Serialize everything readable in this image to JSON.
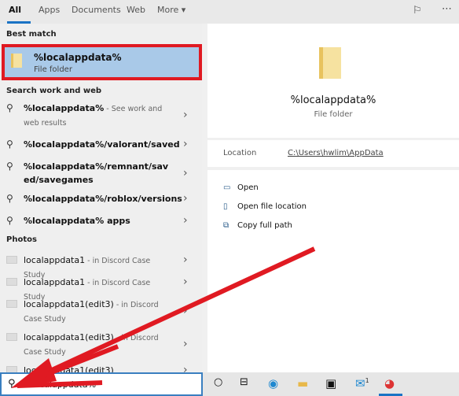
{
  "tabs": [
    "All",
    "Apps",
    "Documents",
    "Web",
    "More ▾"
  ],
  "best_match": {
    "heading": "Best match",
    "title": "%localappdata%",
    "subtitle": "File folder"
  },
  "web": {
    "heading": "Search work and web",
    "items": [
      {
        "bold": "%localappdata%",
        "rest": " - See work and web results"
      },
      {
        "bold": "",
        "rest": "%localappdata%/valorant/saved",
        "boldRest": true
      },
      {
        "bold": "",
        "rest": "%localappdata%/remnant/saved/savegames",
        "boldRest": true
      },
      {
        "bold": "",
        "rest": "%localappdata%/roblox/versions",
        "boldRest": true
      },
      {
        "bold": "",
        "rest": "%localappdata% apps",
        "boldRest": true
      }
    ]
  },
  "photos": {
    "heading": "Photos",
    "items": [
      {
        "name": "localappdata1",
        "loc": " - in Discord Case Study"
      },
      {
        "name": "localappdata1",
        "loc": " - in Discord Case Study"
      },
      {
        "name": "localappdata1(edit3)",
        "loc": " - in Discord Case Study"
      },
      {
        "name": "localappdata1(edit3)",
        "loc": " - in Discord Case Study"
      },
      {
        "name": "localappdata1(edit3)",
        "loc": ""
      }
    ]
  },
  "preview": {
    "title": "%localappdata%",
    "subtitle": "File folder",
    "location_label": "Location",
    "location_value": "C:\\Users\\hwlim\\AppData",
    "actions": [
      "Open",
      "Open file location",
      "Copy full path"
    ]
  },
  "search": {
    "value": "%localappdata%"
  },
  "taskbar": {
    "mail_badge": "1"
  },
  "colors": {
    "highlight": "#a9c9e8",
    "annotation": "#e01a22",
    "accent": "#1a73c4"
  }
}
